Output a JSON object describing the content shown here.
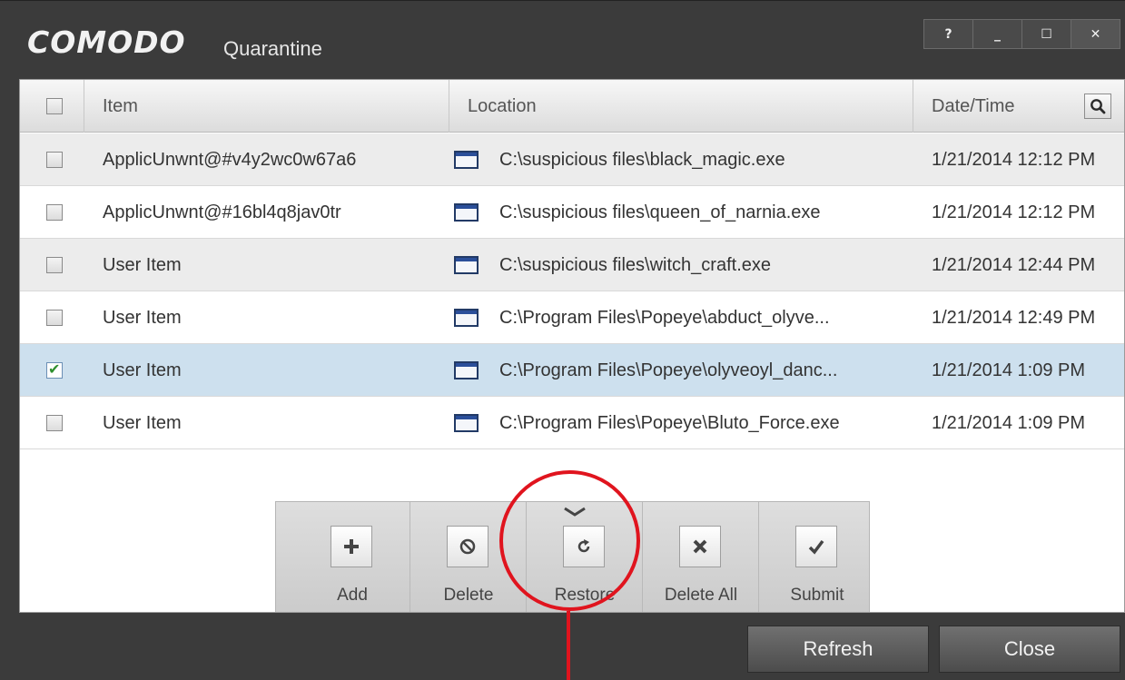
{
  "window": {
    "brand": "COMODO",
    "title": "Quarantine",
    "controls": {
      "help": "?",
      "minimize": "_",
      "maximize": "☐",
      "close": "✕"
    }
  },
  "table": {
    "columns": {
      "item": "Item",
      "location": "Location",
      "datetime": "Date/Time"
    },
    "rows": [
      {
        "item": "ApplicUnwnt@#v4y2wc0w67a6",
        "location": "C:\\suspicious files\\black_magic.exe",
        "datetime": "1/21/2014 12:12 PM",
        "checked": false
      },
      {
        "item": "ApplicUnwnt@#16bl4q8jav0tr",
        "location": "C:\\suspicious files\\queen_of_narnia.exe",
        "datetime": "1/21/2014 12:12 PM",
        "checked": false
      },
      {
        "item": "User Item",
        "location": "C:\\suspicious files\\witch_craft.exe",
        "datetime": "1/21/2014 12:44 PM",
        "checked": false
      },
      {
        "item": "User Item",
        "location": "C:\\Program Files\\Popeye\\abduct_olyve...",
        "datetime": "1/21/2014 12:49 PM",
        "checked": false
      },
      {
        "item": "User Item",
        "location": "C:\\Program Files\\Popeye\\olyveoyl_danc...",
        "datetime": "1/21/2014 1:09 PM",
        "checked": true
      },
      {
        "item": "User Item",
        "location": "C:\\Program Files\\Popeye\\Bluto_Force.exe",
        "datetime": "1/21/2014 1:09 PM",
        "checked": false
      }
    ]
  },
  "toolbar": {
    "add": "Add",
    "delete": "Delete",
    "restore": "Restore",
    "delete_all": "Delete All",
    "submit": "Submit"
  },
  "footer": {
    "refresh": "Refresh",
    "close": "Close"
  },
  "colors": {
    "annotation": "#e0141e",
    "selected_row": "#cde0ee",
    "window_bg": "#3b3b3b"
  }
}
